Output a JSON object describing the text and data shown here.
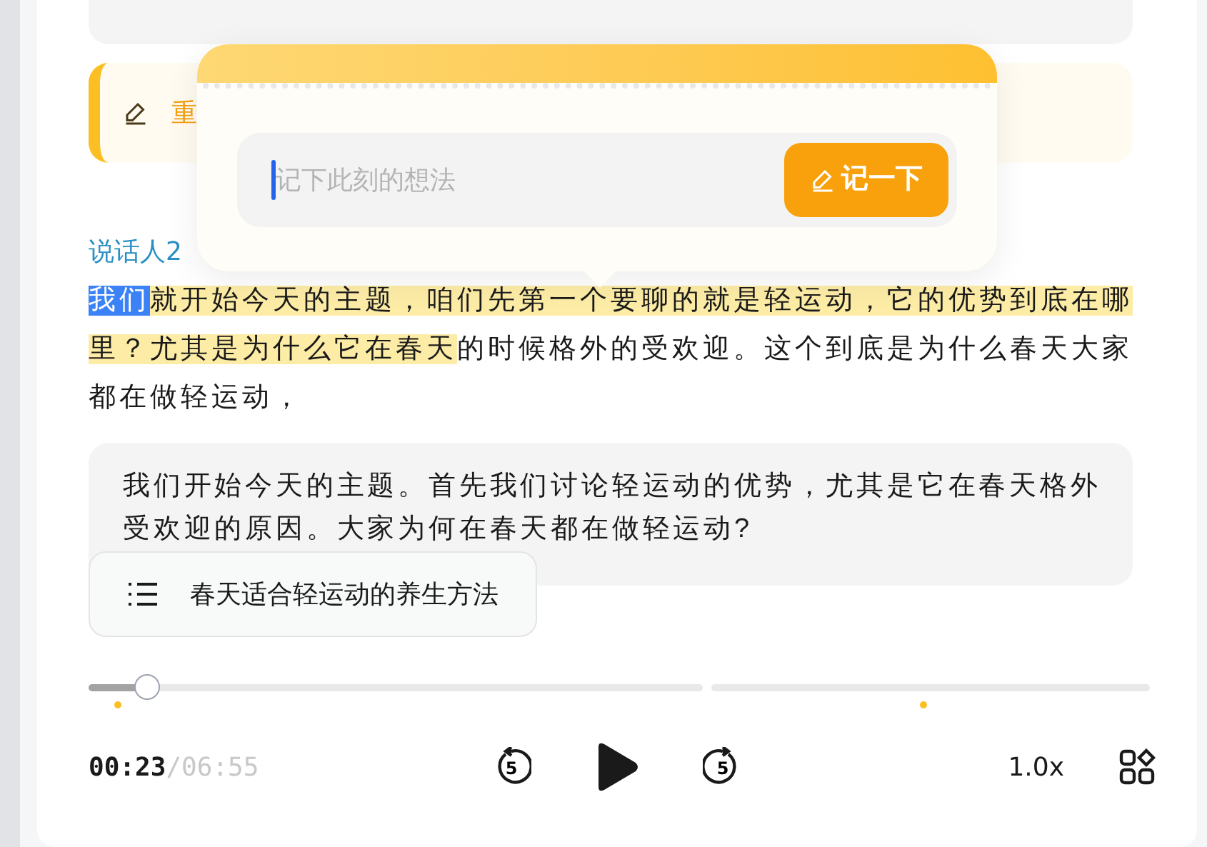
{
  "note_banner": {
    "text": "重"
  },
  "note_popup": {
    "placeholder": "记下此刻的想法",
    "button": "记一下"
  },
  "speaker": "说话人2",
  "transcript": [
    {
      "kind": "selected",
      "text": "我们"
    },
    {
      "kind": "highlight",
      "text": "就开始今天的主题，咱们先第一个要聊的就是轻运动，它的优势到底在哪里？尤其是为什么它在春天"
    },
    {
      "kind": "plain",
      "text": "的时候格外的受欢迎。这个到底是为什么春天大家都在做轻运动，"
    }
  ],
  "summary": "我们开始今天的主题。首先我们讨论轻运动的优势，尤其是它在春天格外受欢迎的原因。大家为何在春天都在做轻运动?",
  "chapter": "春天适合轻运动的养生方法",
  "player": {
    "level": 0.055,
    "current": "00:23",
    "total": "/06:55",
    "rewind": "5",
    "forward": "5",
    "speed": "1.0x"
  }
}
